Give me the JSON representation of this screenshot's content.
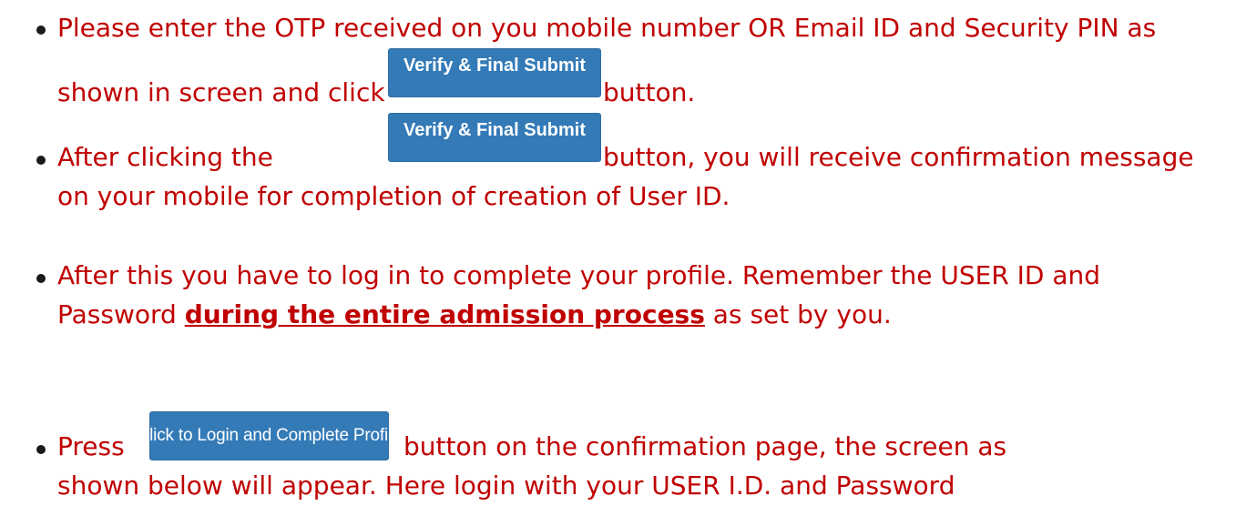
{
  "instructions": [
    {
      "line1": "Please enter the OTP received on you mobile number OR Email ID and Security PIN as",
      "line2_before": "shown in screen and click",
      "button": "Verify & Final Submit",
      "line2_after": "button."
    },
    {
      "line1_before": "After clicking the",
      "button": "Verify & Final Submit",
      "line1_after": "button, you will receive confirmation message",
      "line2": "on your mobile for completion of creation of User ID."
    },
    {
      "line1": "After this you have to log in to complete your profile. Remember the USER ID and",
      "line2_before": "Password",
      "line2_emphasis": "during the entire admission process",
      "line2_after": "as set by you."
    },
    {
      "line1_before": "Press",
      "button": "Click to Login and Complete Profile",
      "line1_after": "button on the confirmation page, the screen as",
      "line2": "shown below will appear. Here login with your USER I.D. and Password"
    }
  ],
  "colors": {
    "text": "#c00000",
    "button_bg": "#337ab7",
    "button_text": "#ffffff"
  }
}
